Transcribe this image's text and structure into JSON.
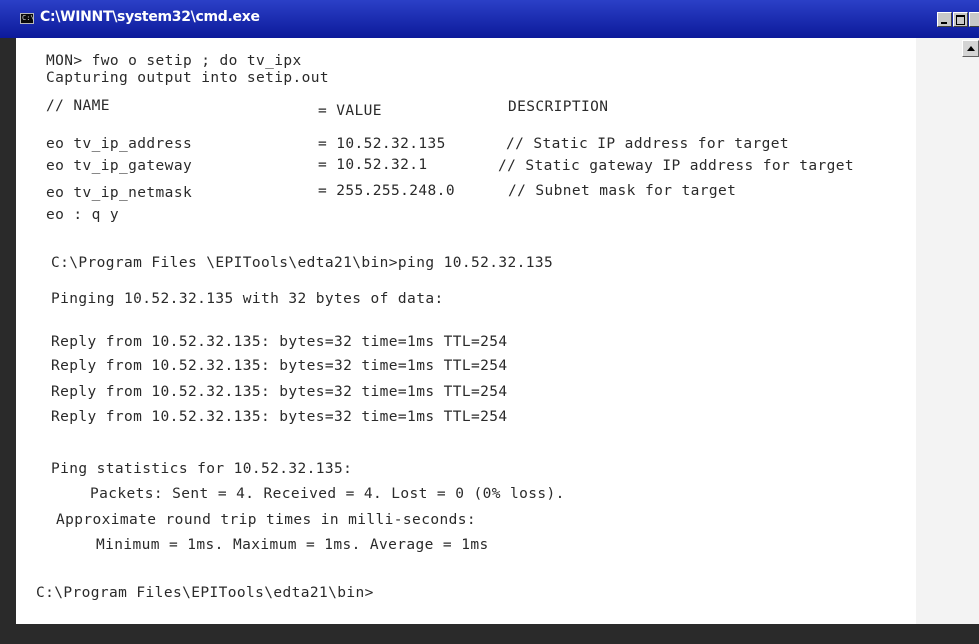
{
  "window": {
    "title": "C:\\WINNT\\system32\\cmd.exe",
    "icon": "console-icon",
    "icon_text": "C:\\"
  },
  "console": {
    "prompt_line": "MON> fwo o setip ; do tv_ipx",
    "capture_line": "Capturing output into setip.out",
    "table_header": {
      "name": "// NAME",
      "value": "= VALUE",
      "description": "DESCRIPTION"
    },
    "settings": [
      {
        "name": "eo tv_ip_address",
        "value": "= 10.52.32.135",
        "description": "// Static IP address for target"
      },
      {
        "name": "eo tv_ip_gateway",
        "value": "= 10.52.32.1",
        "description": "// Static gateway IP address for target"
      },
      {
        "name": "eo tv_ip_netmask",
        "value": "= 255.255.248.0",
        "description": "// Subnet mask for target"
      }
    ],
    "quit_line": "eo : q y",
    "ping_command": "C:\\Program Files \\EPITools\\edta21\\bin>ping 10.52.32.135",
    "pinging_line": "Pinging 10.52.32.135 with 32 bytes of data:",
    "replies": [
      "Reply from 10.52.32.135: bytes=32 time=1ms TTL=254",
      "Reply from 10.52.32.135: bytes=32 time=1ms TTL=254",
      "Reply from 10.52.32.135: bytes=32 time=1ms TTL=254",
      "Reply from 10.52.32.135: bytes=32 time=1ms TTL=254"
    ],
    "stats_header": "Ping statistics for 10.52.32.135:",
    "packets_line": "Packets: Sent = 4. Received = 4. Lost = 0 (0% loss).",
    "rtt_header": "Approximate round trip times in milli-seconds:",
    "rtt_line": "Minimum = 1ms. Maximum = 1ms. Average = 1ms",
    "final_prompt": "C:\\Program Files\\EPITools\\edta21\\bin>"
  },
  "colors": {
    "titlebar": "#0c1a9a",
    "console_bg": "#ffffff",
    "console_text": "#2a2a2a"
  }
}
